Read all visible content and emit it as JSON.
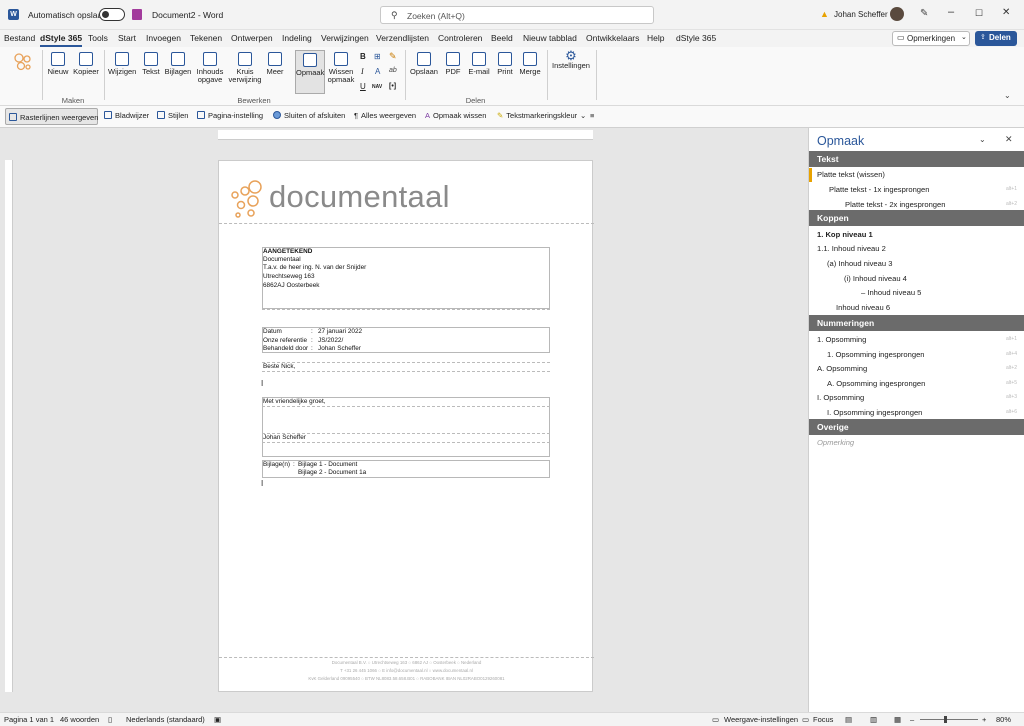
{
  "titlebar": {
    "autosave_label": "Automatisch opslaan",
    "doc_title": "Document2 - Word",
    "search_placeholder": "Zoeken (Alt+Q)",
    "user_name": "Johan Scheffer",
    "warn_color": "#e8a200"
  },
  "menu": [
    "Bestand",
    "dStyle 365",
    "Tools",
    "Start",
    "Invoegen",
    "Tekenen",
    "Ontwerpen",
    "Indeling",
    "Verwijzingen",
    "Verzendlijsten",
    "Controleren",
    "Beeld",
    "Nieuw tabblad",
    "Ontwikkelaars",
    "Help",
    "dStyle 365"
  ],
  "menu_right": {
    "comments": "Opmerkingen",
    "share": "Delen"
  },
  "ribbon": {
    "maken": {
      "label": "Maken",
      "nieuw": "Nieuw",
      "kopieer": "Kopieer"
    },
    "bewerken": {
      "label": "Bewerken",
      "wijzigen": "Wijzigen",
      "tekst": "Tekst",
      "bijlagen": "Bijlagen",
      "inhoud1": "Inhouds",
      "inhoud2": "opgave",
      "kruis1": "Kruis",
      "kruis2": "verwijzing",
      "meer": "Meer",
      "opmaak": "Opmaak",
      "wissen1": "Wissen",
      "wissen2": "opmaak",
      "fmt_b": "B",
      "fmt_i": "I",
      "fmt_u": "U",
      "fmt_nav": "NAV",
      "fmt_br": "[•]"
    },
    "delen": {
      "label": "Delen",
      "opslaan": "Opslaan",
      "pdf": "PDF",
      "email": "E-mail",
      "print": "Print",
      "merge": "Merge"
    },
    "instellingen": "Instellingen"
  },
  "toolbar2": [
    "Rasterlijnen weergeven",
    "Bladwijzer",
    "Stijlen",
    "Pagina-instelling",
    "Sluiten of afsluiten",
    "Alles weergeven",
    "Opmaak wissen",
    "Tekstmarkeringskleur"
  ],
  "doc": {
    "logo_text": "documentaal",
    "brand_color": "#e8a25a",
    "address": [
      "AANGETEKEND",
      "Documentaal",
      "T.a.v. de heer ing. N. van der Snijder",
      "Utrechtseweg 163",
      "6862AJ  Oosterbeek"
    ],
    "meta": [
      [
        "Datum",
        ":",
        "27 januari 2022"
      ],
      [
        "Onze referentie",
        ":",
        "JS/2022/"
      ],
      [
        "Behandeld door",
        ":",
        "Johan Scheffer"
      ]
    ],
    "salutation": "Beste Nick,",
    "closing": "Met vriendelijke groet,",
    "signer": "Johan Scheffer",
    "bijlage_label": "Bijlage(n)",
    "bijlage_colon": ":",
    "bijlagen": [
      "Bijlage 1 - Document",
      "Bijlage 2 - Document 1a"
    ],
    "footer": [
      "Documentaal B.V. ○ Utrechtseweg 163 ○ 6862 AJ ○ Oosterbeek ○ Nederland",
      "T +31 26 445 1066 ○ E info@documentaal.nl ○ www.documentaal.nl",
      "KvK Gelderland 09095540 ○ BTW NL8083.58.658.B01 ○ RABOBANK IBAN NL02RABO0129260081"
    ]
  },
  "pane": {
    "title": "Opmaak",
    "sections": [
      {
        "header": "Tekst",
        "items": [
          {
            "label": "Platte tekst (wissen)",
            "sc": ""
          },
          {
            "label": "Platte tekst - 1x ingesprongen",
            "sc": "alt+1"
          },
          {
            "label": "Platte tekst - 2x ingesprongen",
            "sc": "alt+2"
          }
        ]
      },
      {
        "header": "Koppen",
        "items": [
          {
            "label": "1.  Kop niveau 1",
            "sc": ""
          },
          {
            "label": "1.1.  Inhoud niveau 2",
            "sc": ""
          },
          {
            "label": "(a)  Inhoud niveau 3",
            "sc": ""
          },
          {
            "label": "(i)  Inhoud niveau 4",
            "sc": ""
          },
          {
            "label": "–  Inhoud niveau 5",
            "sc": ""
          },
          {
            "label": "Inhoud niveau 6",
            "sc": ""
          }
        ]
      },
      {
        "header": "Nummeringen",
        "items": [
          {
            "label": "1.  Opsomming",
            "sc": "alt+1"
          },
          {
            "label": "1.  Opsomming ingesprongen",
            "sc": "alt+4"
          },
          {
            "label": "A.  Opsomming",
            "sc": "alt+2"
          },
          {
            "label": "A.  Opsomming ingesprongen",
            "sc": "alt+5"
          },
          {
            "label": "I.  Opsomming",
            "sc": "alt+3"
          },
          {
            "label": "I.  Opsomming ingesprongen",
            "sc": "alt+6"
          }
        ]
      },
      {
        "header": "Overige",
        "items": [
          {
            "label": "Opmerking",
            "sc": ""
          }
        ]
      }
    ]
  },
  "status": {
    "page": "Pagina 1 van 1",
    "words": "46 woorden",
    "lang": "Nederlands (standaard)",
    "display": "Weergave-instellingen",
    "focus": "Focus",
    "zoom": "80%"
  }
}
